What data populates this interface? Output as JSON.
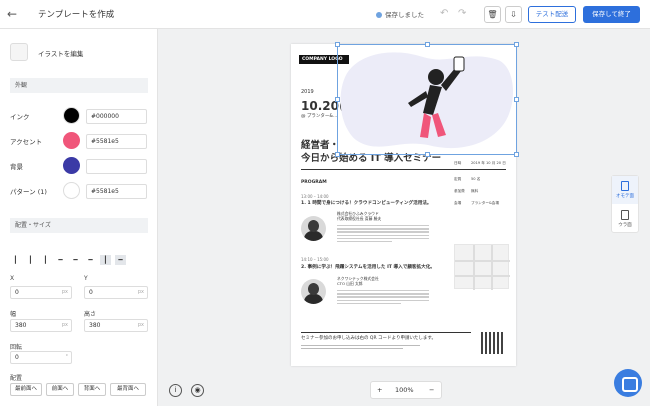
{
  "header": {
    "back_icon": "arrow-left-icon",
    "title": "テンプレートを作成",
    "status": "保存しました",
    "test_send": "テスト配送",
    "save_finish": "保存して終了"
  },
  "left": {
    "illustration_label": "イラストを編集",
    "appearance_section": "外観",
    "colors": [
      {
        "label": "インク",
        "color": "#000000",
        "value": "#000000"
      },
      {
        "label": "アクセント",
        "color": "#f0567a",
        "value": "#5581e5"
      },
      {
        "label": "背景",
        "color": "#3b3aa6",
        "value": ""
      },
      {
        "label": "パターン (1)",
        "color": "#ffffff",
        "value": "#5581e5"
      }
    ],
    "layout_section": "配置・サイズ",
    "x_label": "X",
    "x_value": "0",
    "y_label": "Y",
    "y_value": "0",
    "w_label": "幅",
    "w_value": "380",
    "h_label": "高さ",
    "h_value": "380",
    "unit": "px",
    "rotate_label": "回転",
    "rotate_value": "0",
    "rotate_unit": "°",
    "order_label": "配置",
    "order_buttons": [
      "最前面へ",
      "前面へ",
      "背面へ",
      "最背面へ"
    ]
  },
  "doc": {
    "logo": "COMPANY LOGO",
    "year": "2019",
    "date": "10.20(日)",
    "place": "@ プランター&...",
    "title": "経営者・\n今日から始める IT 導入セミナー",
    "program": "PROGRAM",
    "t1": "13:00 – 14:00",
    "s1": "1. 1 時間で身につける！クラウドコンピューティング活用法。",
    "sp1": "株式会社ひふみクラウド\n代表取締役社長 斎藤 勝夫",
    "t2": "14:10 – 15:00",
    "s2": "2. 事例に学ぶ！飛躍システムを活用した IT 導入で顧客拡大化。",
    "sp2": "ネクワシテック株式会社\nCTO 山田 太郎",
    "info": [
      {
        "k": "日時",
        "v": "2019 年 10 月 20 日"
      },
      {
        "k": "定員",
        "v": "50 名"
      },
      {
        "k": "参加費",
        "v": "無料"
      },
      {
        "k": "会場",
        "v": "プランター&会場"
      }
    ],
    "footer": "セミナー参加のお申し込みは右の QR コードより申請いたします。"
  },
  "side_tabs": [
    "オモテ面",
    "ウラ面"
  ],
  "zoom": {
    "minus": "−",
    "value": "100%",
    "plus": "+"
  },
  "colors": {
    "primary": "#2d6fdc",
    "selection": "#6fa3e0",
    "illus_blob": "#ececf8"
  }
}
